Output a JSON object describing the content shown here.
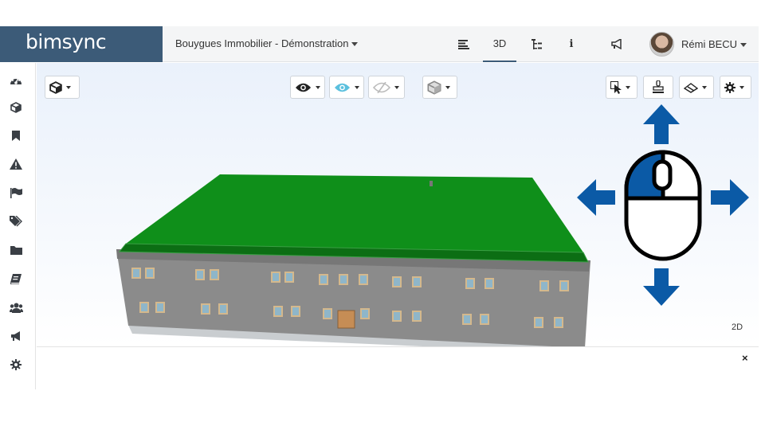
{
  "brand": {
    "logo_text": "bimsync",
    "accent": "#3c5b78"
  },
  "header": {
    "project_name": "Bouygues Immobilier - Démonstration",
    "nav": [
      {
        "icon": "list-icon",
        "label": ""
      },
      {
        "icon": "3d-label",
        "label": "3D"
      },
      {
        "icon": "tree-icon",
        "label": ""
      },
      {
        "icon": "info-icon",
        "label": "i"
      },
      {
        "icon": "megaphone-icon",
        "label": ""
      }
    ],
    "user_name": "Rémi BECU"
  },
  "sidebar": {
    "items": [
      {
        "icon": "dashboard-icon"
      },
      {
        "icon": "cube-icon"
      },
      {
        "icon": "bookmark-icon"
      },
      {
        "icon": "warning-icon"
      },
      {
        "icon": "flag-icon"
      },
      {
        "icon": "tags-icon"
      },
      {
        "icon": "folder-icon"
      },
      {
        "icon": "book-icon"
      },
      {
        "icon": "users-icon"
      },
      {
        "icon": "megaphone-icon"
      },
      {
        "icon": "settings-icon"
      }
    ]
  },
  "viewer": {
    "toolbar": [
      {
        "icon": "cube-menu-icon"
      },
      {
        "icon": "eye-icon"
      },
      {
        "icon": "eye-xray-icon"
      },
      {
        "icon": "eye-hidden-icon"
      },
      {
        "icon": "box-view-icon"
      },
      {
        "icon": "select-cursor-icon"
      },
      {
        "icon": "stamp-icon"
      },
      {
        "icon": "section-plane-icon"
      },
      {
        "icon": "gear-icon"
      }
    ],
    "mode_2d_label": "2D",
    "colors": {
      "roof": "#0f8f1a",
      "walls": "#8b8b8b",
      "arrows": "#0b5aa6"
    }
  },
  "panel": {
    "close_label": "×"
  }
}
